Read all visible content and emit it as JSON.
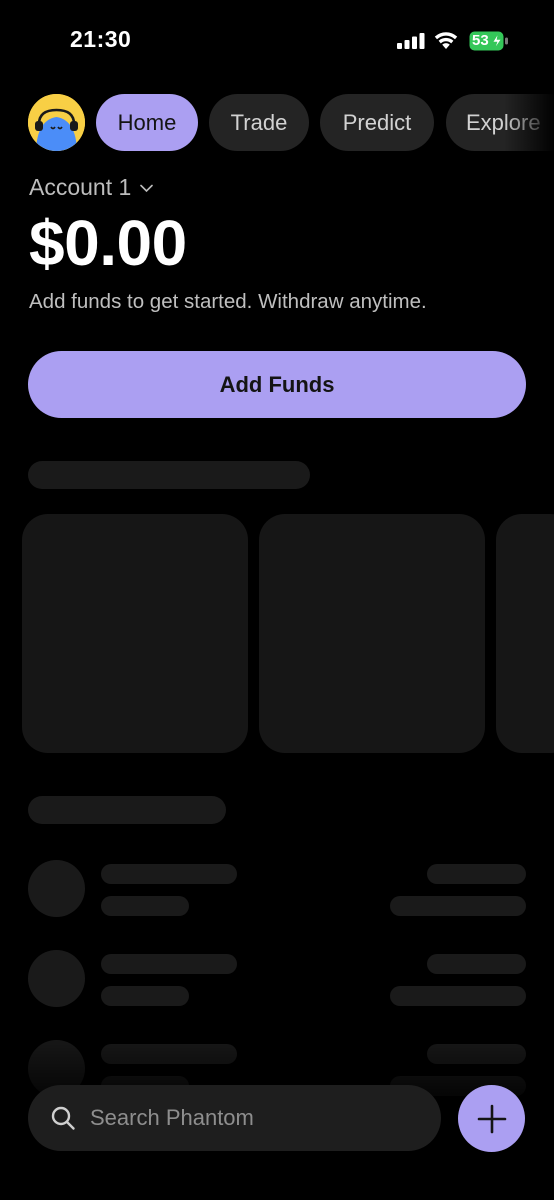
{
  "status_bar": {
    "time": "21:30",
    "battery_level": "53",
    "battery_color": "#4cd964",
    "icons": [
      "signal-icon",
      "wifi-icon",
      "battery-charging-icon"
    ]
  },
  "nav": {
    "avatar_icon": "avatar-face-icon",
    "tabs": [
      {
        "label": "Home",
        "active": true
      },
      {
        "label": "Trade",
        "active": false
      },
      {
        "label": "Predict",
        "active": false
      },
      {
        "label": "Explore",
        "active": false
      }
    ]
  },
  "account": {
    "name": "Account 1",
    "balance": "$0.00",
    "subtitle": "Add funds to get started. Withdraw anytime."
  },
  "actions": {
    "add_funds_label": "Add Funds"
  },
  "search": {
    "placeholder": "Search Phantom",
    "value": ""
  },
  "colors": {
    "accent": "#ab9ff2",
    "background": "#000000",
    "surface": "#242424",
    "skeleton": "#1a1a1a"
  }
}
